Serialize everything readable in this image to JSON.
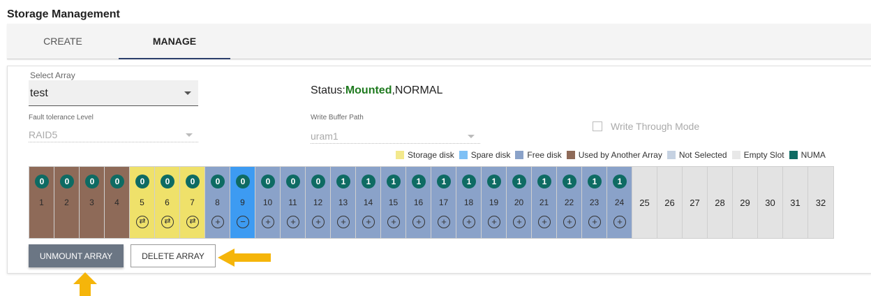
{
  "app": {
    "title": "Storage Management"
  },
  "tabs": {
    "create": "CREATE",
    "manage": "MANAGE"
  },
  "array_select": {
    "label": "Select Array",
    "value": "test"
  },
  "fault_tolerance": {
    "label": "Fault tolerance Level",
    "value": "RAID5"
  },
  "write_buffer": {
    "label": "Write Buffer Path",
    "value": "uram1"
  },
  "status": {
    "prefix": "Status:",
    "mounted": "Mounted",
    "suffix": ",NORMAL"
  },
  "write_through": {
    "label": "Write Through Mode",
    "checked": false
  },
  "legend": [
    {
      "label": "Storage disk",
      "color": "#f3e98d"
    },
    {
      "label": "Spare disk",
      "color": "#7ec0f5"
    },
    {
      "label": "Free disk",
      "color": "#8aa2c9"
    },
    {
      "label": "Used by Another Array",
      "color": "#8e6a58"
    },
    {
      "label": "Not Selected",
      "color": "#c6d2e2"
    },
    {
      "label": "Empty Slot",
      "color": "#e8e8e8"
    },
    {
      "label": "NUMA",
      "color": "#0e6b63"
    }
  ],
  "slot_colors": {
    "used": "#8e6a58",
    "storage": "#efe16a",
    "spare": "#3d9bf2",
    "free": "#8aa2c9",
    "empty": "#e3e3e3"
  },
  "slots": [
    {
      "num": "1",
      "numa": "0",
      "type": "used",
      "action": ""
    },
    {
      "num": "2",
      "numa": "0",
      "type": "used",
      "action": ""
    },
    {
      "num": "3",
      "numa": "0",
      "type": "used",
      "action": ""
    },
    {
      "num": "4",
      "numa": "0",
      "type": "used",
      "action": ""
    },
    {
      "num": "5",
      "numa": "0",
      "type": "storage",
      "action": "swap"
    },
    {
      "num": "6",
      "numa": "0",
      "type": "storage",
      "action": "swap"
    },
    {
      "num": "7",
      "numa": "0",
      "type": "storage",
      "action": "swap"
    },
    {
      "num": "8",
      "numa": "0",
      "type": "free",
      "action": "add"
    },
    {
      "num": "9",
      "numa": "0",
      "type": "spare",
      "action": "remove"
    },
    {
      "num": "10",
      "numa": "0",
      "type": "free",
      "action": "add"
    },
    {
      "num": "11",
      "numa": "0",
      "type": "free",
      "action": "add"
    },
    {
      "num": "12",
      "numa": "0",
      "type": "free",
      "action": "add"
    },
    {
      "num": "13",
      "numa": "1",
      "type": "free",
      "action": "add"
    },
    {
      "num": "14",
      "numa": "1",
      "type": "free",
      "action": "add"
    },
    {
      "num": "15",
      "numa": "1",
      "type": "free",
      "action": "add"
    },
    {
      "num": "16",
      "numa": "1",
      "type": "free",
      "action": "add"
    },
    {
      "num": "17",
      "numa": "1",
      "type": "free",
      "action": "add"
    },
    {
      "num": "18",
      "numa": "1",
      "type": "free",
      "action": "add"
    },
    {
      "num": "19",
      "numa": "1",
      "type": "free",
      "action": "add"
    },
    {
      "num": "20",
      "numa": "1",
      "type": "free",
      "action": "add"
    },
    {
      "num": "21",
      "numa": "1",
      "type": "free",
      "action": "add"
    },
    {
      "num": "22",
      "numa": "1",
      "type": "free",
      "action": "add"
    },
    {
      "num": "23",
      "numa": "1",
      "type": "free",
      "action": "add"
    },
    {
      "num": "24",
      "numa": "1",
      "type": "free",
      "action": "add"
    },
    {
      "num": "25",
      "numa": "",
      "type": "empty",
      "action": ""
    },
    {
      "num": "26",
      "numa": "",
      "type": "empty",
      "action": ""
    },
    {
      "num": "27",
      "numa": "",
      "type": "empty",
      "action": ""
    },
    {
      "num": "28",
      "numa": "",
      "type": "empty",
      "action": ""
    },
    {
      "num": "29",
      "numa": "",
      "type": "empty",
      "action": ""
    },
    {
      "num": "30",
      "numa": "",
      "type": "empty",
      "action": ""
    },
    {
      "num": "31",
      "numa": "",
      "type": "empty",
      "action": ""
    },
    {
      "num": "32",
      "numa": "",
      "type": "empty",
      "action": ""
    }
  ],
  "buttons": {
    "unmount": "UNMOUNT ARRAY",
    "delete": "DELETE ARRAY"
  },
  "annotation_arrow_color": "#f5b50a"
}
